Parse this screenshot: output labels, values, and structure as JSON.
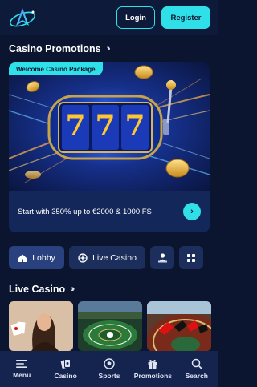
{
  "header": {
    "login_label": "Login",
    "register_label": "Register"
  },
  "promotions": {
    "title": "Casino Promotions",
    "card": {
      "tag": "Welcome Casino Package",
      "reel_symbols": [
        "7",
        "7",
        "7"
      ],
      "text": "Start with 350% up to €2000 & 1000 FS"
    }
  },
  "tabs": [
    {
      "label": "Lobby",
      "icon": "house-icon",
      "active": true
    },
    {
      "label": "Live Casino",
      "icon": "roulette-icon",
      "active": false
    },
    {
      "label": "",
      "icon": "dealer-icon",
      "active": false
    },
    {
      "label": "",
      "icon": "grid-icon",
      "active": false
    }
  ],
  "live_casino": {
    "title": "Live Casino"
  },
  "bottom_nav": [
    {
      "label": "Menu",
      "icon": "menu-icon"
    },
    {
      "label": "Casino",
      "icon": "cards-icon"
    },
    {
      "label": "Sports",
      "icon": "soccer-ball-icon"
    },
    {
      "label": "Promotions",
      "icon": "gift-icon"
    },
    {
      "label": "Search",
      "icon": "search-icon"
    }
  ],
  "colors": {
    "background": "#0b1530",
    "accent": "#2fe0e8",
    "card": "#14275a"
  }
}
